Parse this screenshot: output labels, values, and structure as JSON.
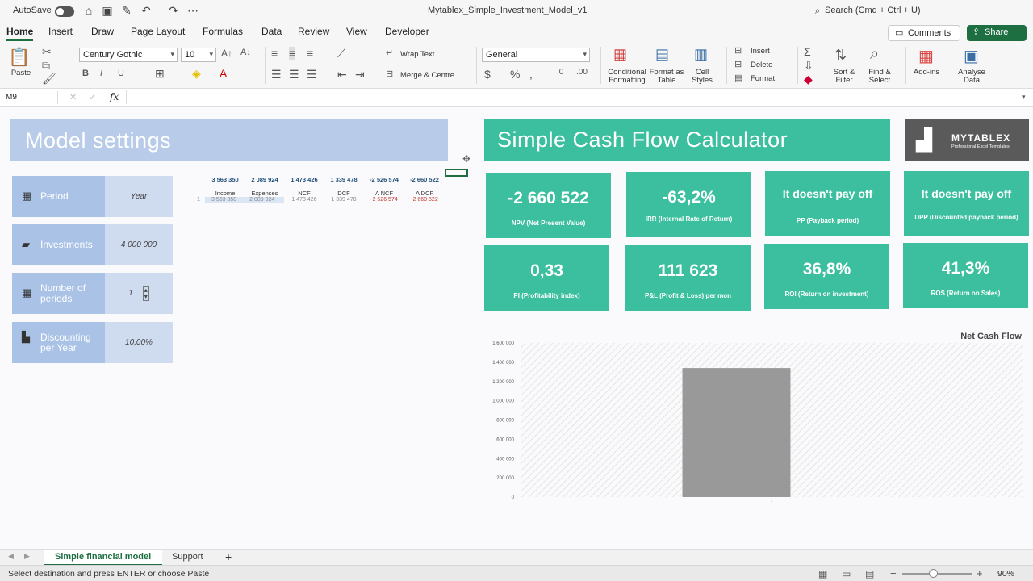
{
  "titlebar": {
    "autosave_label": "AutoSave",
    "doc_title": "Mytablex_Simple_Investment_Model_v1",
    "search_placeholder": "Search (Cmd + Ctrl + U)"
  },
  "tabs": [
    "Home",
    "Insert",
    "Draw",
    "Page Layout",
    "Formulas",
    "Data",
    "Review",
    "View",
    "Developer"
  ],
  "active_tab": "Home",
  "buttons": {
    "comments": "Comments",
    "share": "Share"
  },
  "ribbon": {
    "paste": "Paste",
    "font_name": "Century Gothic",
    "font_size": "10",
    "bold": "B",
    "italic": "I",
    "underline": "U",
    "wrap_text": "Wrap Text",
    "merge_centre": "Merge & Centre",
    "number_format": "General",
    "conditional_formatting": "Conditional Formatting",
    "format_as_table": "Format as Table",
    "cell_styles": "Cell Styles",
    "insert": "Insert",
    "delete": "Delete",
    "format": "Format",
    "sort_filter": "Sort & Filter",
    "find_select": "Find & Select",
    "add_ins": "Add-ins",
    "analyse_data": "Analyse Data"
  },
  "formula_bar": {
    "name_box": "M9",
    "fx": "fx",
    "content": ""
  },
  "model_settings": {
    "title": "Model settings",
    "rows": [
      {
        "label": "Period",
        "value": "Year",
        "icon": "calendar-icon"
      },
      {
        "label": "Investments",
        "value": "4 000 000",
        "icon": "money-icon"
      },
      {
        "label": "Number of periods",
        "value": "1",
        "icon": "calendar-grid-icon"
      },
      {
        "label": "Discounting per Year",
        "value": "10,00%",
        "icon": "bar-chart-icon"
      }
    ]
  },
  "mini_table": {
    "totals": [
      "3 563 350",
      "2 089 924",
      "1 473 426",
      "1 339 478",
      "-2 526 574",
      "-2 660 522"
    ],
    "headers": [
      "Income",
      "Expenses",
      "NCF",
      "DCF",
      "A NCF",
      "A DCF"
    ],
    "row_index": "1",
    "row": [
      "3 563 350",
      "2 089 924",
      "1 473 426",
      "1 339 478",
      "-2 526 574",
      "-2 660 522"
    ]
  },
  "calculator": {
    "title": "Simple Cash Flow Calculator",
    "logo_name": "MYTABLEX",
    "logo_tagline": "Professional Excel Templates",
    "kpis": [
      {
        "value": "-2 660 522",
        "label": "NPV (Net Present Value)"
      },
      {
        "value": "-63,2%",
        "label": "IRR (Internal Rate of Return)"
      },
      {
        "value": "It doesn't pay off",
        "label": "PP (Payback period)"
      },
      {
        "value": "It doesn't pay off",
        "label": "DPP (Discounted payback period)"
      },
      {
        "value": "0,33",
        "label": "PI (Profitability index)"
      },
      {
        "value": "111 623",
        "label": "P&L (Profit & Loss) per mon"
      },
      {
        "value": "36,8%",
        "label": "ROI (Return on investment)"
      },
      {
        "value": "41,3%",
        "label": "ROS (Return on Sales)"
      }
    ]
  },
  "chart_data": {
    "type": "bar",
    "title": "Net Cash Flow",
    "categories": [
      "1"
    ],
    "values": [
      1339478
    ],
    "ylim": [
      0,
      1600000
    ],
    "yticks": [
      "0",
      "200 000",
      "400 000",
      "600 000",
      "800 000",
      "1 000 000",
      "1 200 000",
      "1 400 000",
      "1 600 000"
    ],
    "grid": false,
    "bar_color": "#999999"
  },
  "sheet_tabs": [
    "Simple financial model",
    "Support"
  ],
  "active_sheet": "Simple financial model",
  "status": {
    "message": "Select destination and press ENTER or choose Paste",
    "zoom": "90%"
  },
  "colors": {
    "accent": "#1d6f42",
    "teal": "#3bbf9e",
    "settings_blue": "#a9c2e6"
  }
}
